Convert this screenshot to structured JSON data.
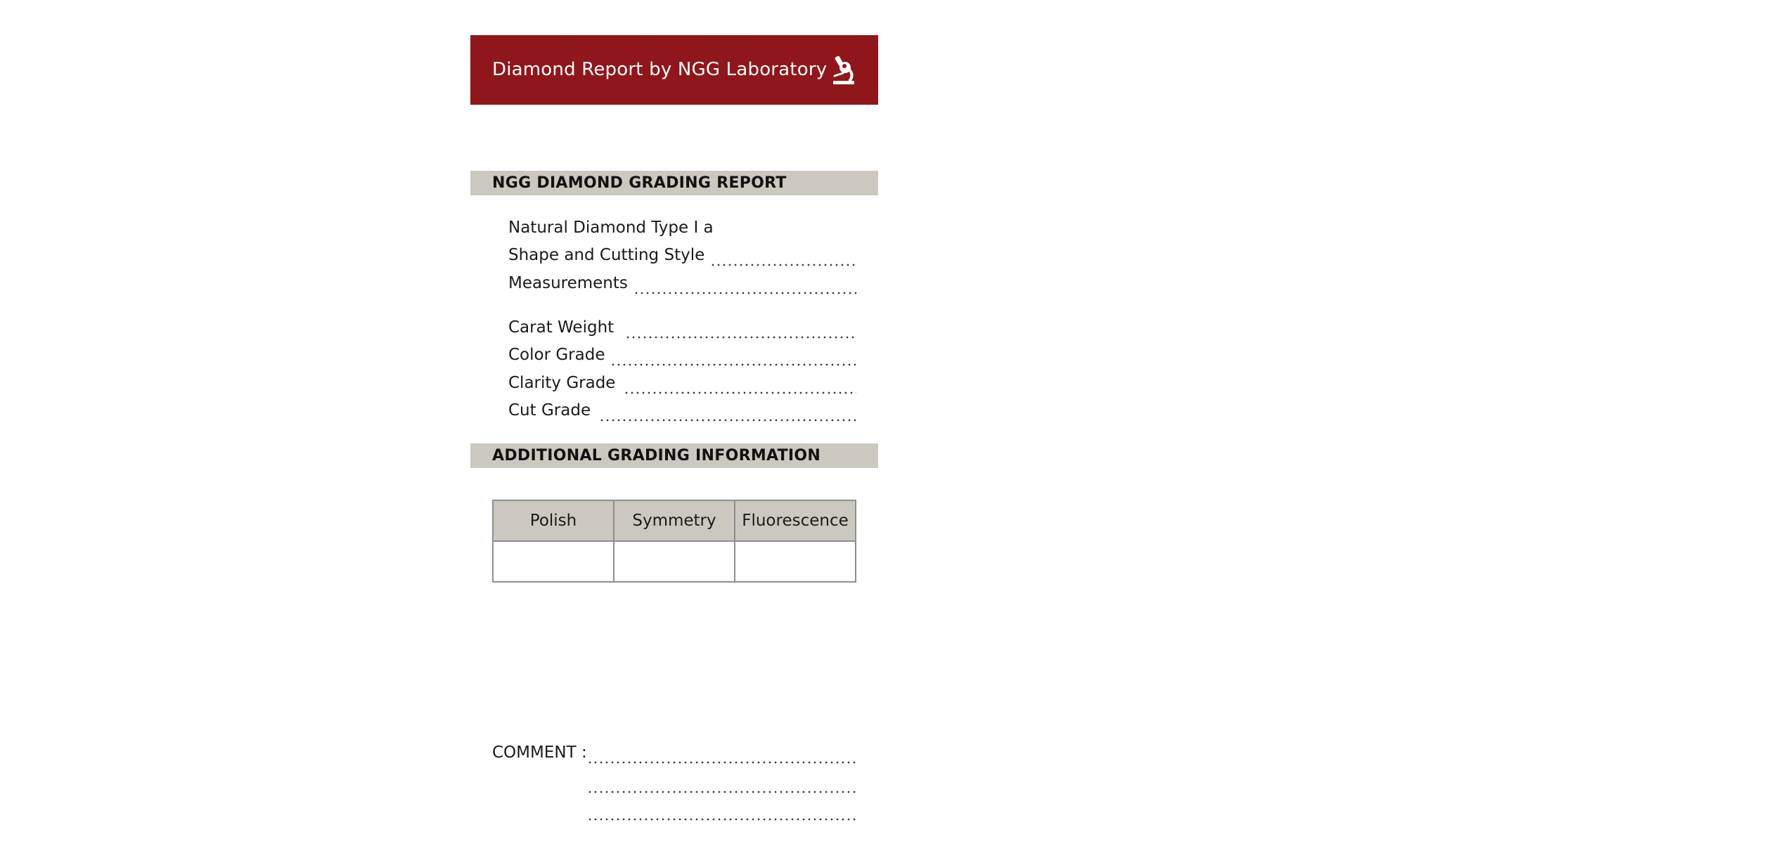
{
  "header": {
    "title": "Diamond Report by NGG Laboratory",
    "icon": "microscope-icon",
    "background_color": "#8f171c"
  },
  "report_section": {
    "heading": "NGG DIAMOND GRADING REPORT",
    "type_line": "Natural Diamond Type I a",
    "fields": {
      "shape": "Shape and Cutting Style",
      "measurements": "Measurements",
      "carat": "Carat Weight",
      "color": "Color Grade",
      "clarity": "Clarity Grade",
      "cut": "Cut Grade"
    }
  },
  "additional_section": {
    "heading": "ADDITIONAL GRADING INFORMATION",
    "table": {
      "headers": [
        "Polish",
        "Symmetry",
        "Fluorescence"
      ],
      "values": [
        "",
        "",
        ""
      ]
    }
  },
  "comment": {
    "label": "COMMENT :"
  },
  "colors": {
    "section_bar": "#cbc8bf",
    "table_border": "#8e8e8e"
  }
}
